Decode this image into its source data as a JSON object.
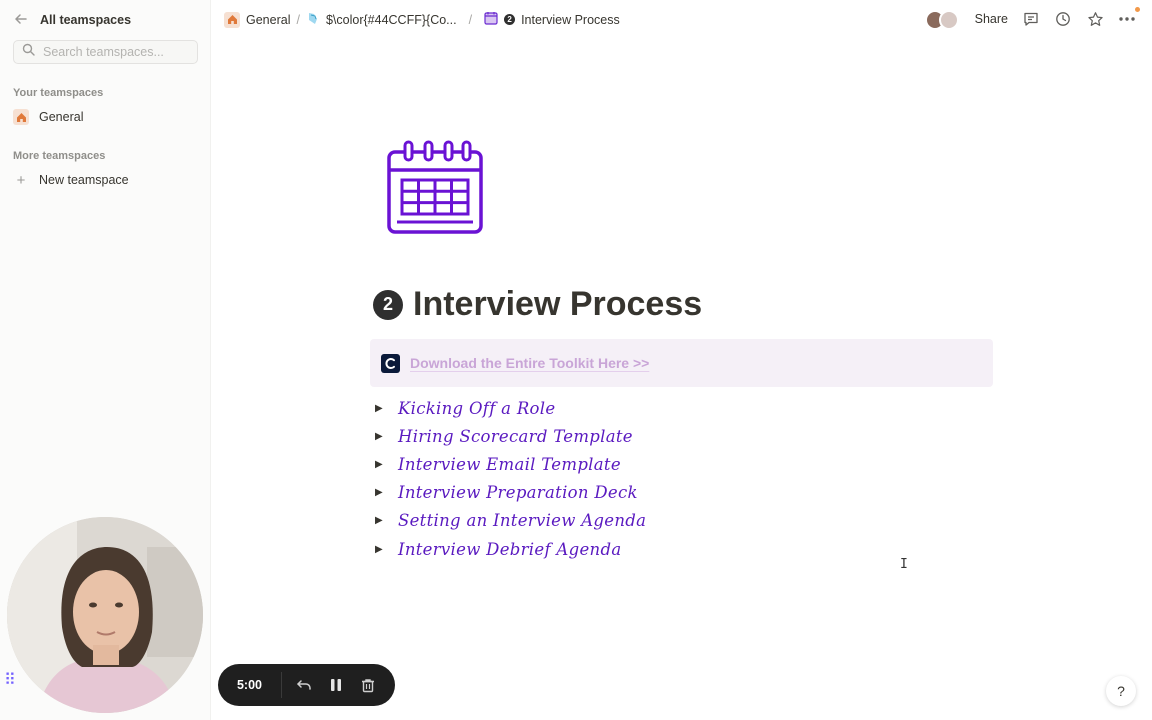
{
  "sidebar": {
    "header_title": "All teamspaces",
    "search_placeholder": "Search teamspaces...",
    "your_teamspaces_label": "Your teamspaces",
    "your_teamspaces": [
      {
        "label": "General",
        "icon": "house-icon"
      }
    ],
    "more_teamspaces_label": "More teamspaces",
    "new_teamspace_label": "New teamspace"
  },
  "breadcrumbs": [
    {
      "label": "General",
      "icon": "house-icon"
    },
    {
      "label": "$\\color{#44CCFF}{Co...",
      "icon": "page-icon"
    },
    {
      "label": "Interview Process",
      "icon": "calendar-icon",
      "badge": "2"
    }
  ],
  "topbar": {
    "share_label": "Share",
    "icons": [
      "comments-icon",
      "history-icon",
      "star-icon",
      "more-icon"
    ]
  },
  "page": {
    "title": "Interview Process",
    "title_badge": "2",
    "icon": "calendar-icon",
    "accent_color": "#5a1ac0",
    "callout": {
      "logo_letter": "C",
      "link_text": "Download the Entire Toolkit Here >>",
      "background": "#f5f0f7"
    },
    "toggles": [
      "Kicking Off a Role",
      "Hiring Scorecard Template",
      "Interview Email Template",
      "Interview Preparation Deck",
      "Setting an Interview Agenda",
      "Interview Debrief Agenda"
    ]
  },
  "recorder": {
    "time": "5:00",
    "icons": [
      "undo-icon",
      "pause-icon",
      "trash-icon"
    ]
  },
  "help_label": "?"
}
